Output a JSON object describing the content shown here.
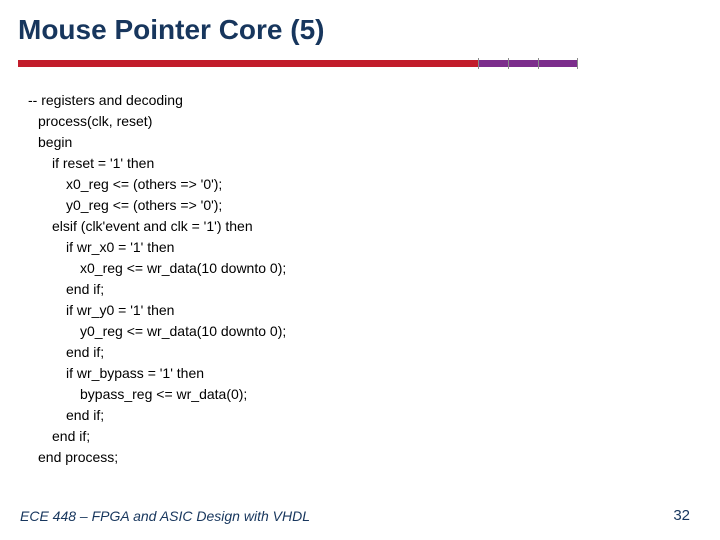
{
  "title": "Mouse Pointer Core (5)",
  "code": {
    "l0": "-- registers and decoding",
    "l1": "process(clk, reset)",
    "l2": "begin",
    "l3": "if reset = '1' then",
    "l4": "x0_reg <= (others => '0');",
    "l5": "y0_reg <= (others => '0');",
    "l6": "elsif (clk'event and clk = '1') then",
    "l7": "if wr_x0 = '1' then",
    "l8": "x0_reg <= wr_data(10 downto 0);",
    "l9": "end if;",
    "l10": "if wr_y0 = '1' then",
    "l11": "y0_reg <= wr_data(10 downto 0);",
    "l12": "end if;",
    "l13": "if wr_bypass = '1' then",
    "l14": "bypass_reg <= wr_data(0);",
    "l15": "end if;",
    "l16": "end if;",
    "l17": "end process;"
  },
  "footer": {
    "left": "ECE 448 – FPGA and ASIC Design with VHDL",
    "right": "32"
  }
}
